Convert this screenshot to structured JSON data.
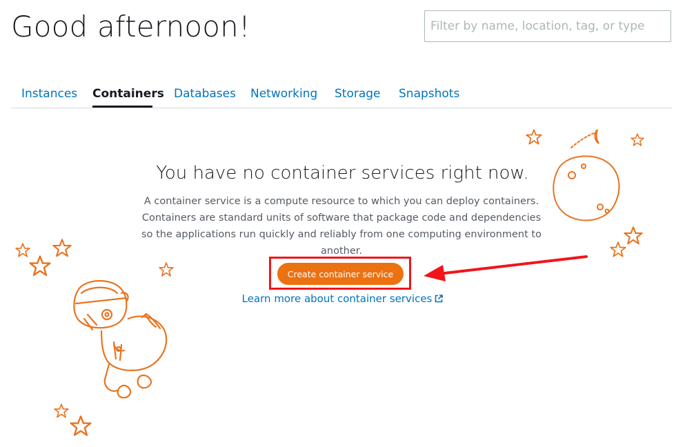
{
  "header": {
    "greeting": "Good afternoon!",
    "search_placeholder": "Filter by name, location, tag, or type"
  },
  "tabs": [
    {
      "label": "Instances",
      "active": false
    },
    {
      "label": "Containers",
      "active": true
    },
    {
      "label": "Databases",
      "active": false
    },
    {
      "label": "Networking",
      "active": false
    },
    {
      "label": "Storage",
      "active": false
    },
    {
      "label": "Snapshots",
      "active": false
    }
  ],
  "empty_state": {
    "title": "You have no container services right now.",
    "description": "A container service is a compute resource to which you can deploy containers. Containers are standard units of software that package code and dependencies so the applications run quickly and reliably from one computing environment to another.",
    "create_button_label": "Create container service",
    "learn_more_label": "Learn more about container services"
  },
  "icons": {
    "external_link": "external-link-icon",
    "illustration": "astronaut-illustration",
    "planet": "planet-illustration",
    "stars": "star-icon"
  },
  "colors": {
    "accent": "#ec7211",
    "link": "#0073bb",
    "annotation": "#f1151a",
    "illustration": "#e8731f"
  }
}
